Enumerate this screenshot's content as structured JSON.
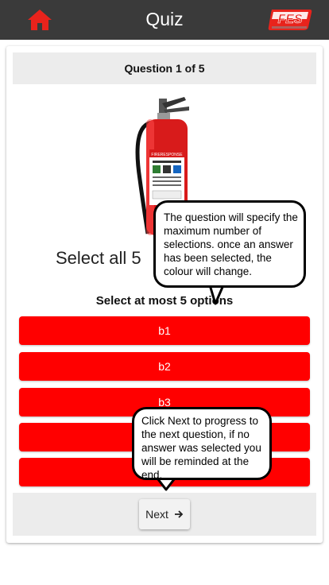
{
  "header": {
    "title": "Quiz",
    "logo_text": "FES",
    "home_icon": "home-icon",
    "colors": {
      "bar": "#3a3a3a",
      "home": "#e8231c",
      "logo": "#e8231c"
    }
  },
  "question": {
    "counter": "Question 1 of 5",
    "text": "Select all 5",
    "instruction": "Select at most 5 options",
    "image_label": "FIRERESPONSE"
  },
  "options": [
    {
      "label": "b1"
    },
    {
      "label": "b2"
    },
    {
      "label": "b3"
    },
    {
      "label": ""
    },
    {
      "label": ""
    }
  ],
  "footer": {
    "next_label": "Next",
    "next_icon": "arrow-right-icon"
  },
  "tooltips": {
    "selection": "The question will specify the maximum number of selections. once an answer has been selected, the colour will change.",
    "next": "Click Next to progress to the next question, if no answer was selected you will be reminded at the end."
  },
  "colors": {
    "option": "#ff0000",
    "panel": "#ececec"
  }
}
